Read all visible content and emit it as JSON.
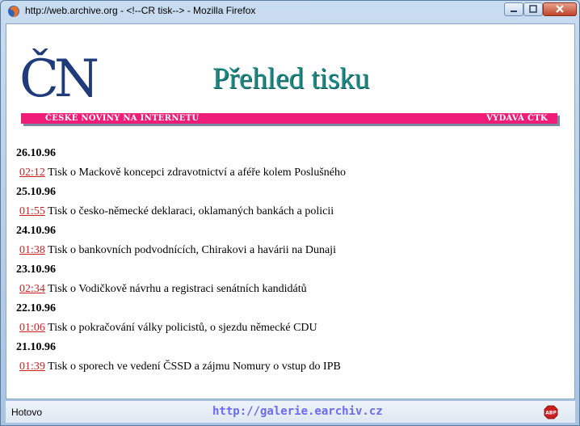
{
  "window": {
    "title": "http://web.archive.org - <!--CR tisk--> - Mozilla Firefox"
  },
  "page": {
    "logo_text": "ČN",
    "title": "Přehled tisku",
    "banner_left": "ČESKÉ NOVINY NA INTERNETU",
    "banner_right": "VYDÁVÁ ČTK",
    "banner_color": "#ef1c78",
    "title_color": "#1a8a84",
    "logo_color": "#1f3b7a",
    "link_color": "#cc2222",
    "entries": [
      {
        "date": "26.10.96",
        "time": "02:12",
        "text": " Tisk o Mackově koncepci zdravotnictví a aféře kolem Poslušného"
      },
      {
        "date": "25.10.96",
        "time": "01:55",
        "text": " Tisk o česko-německé deklaraci, oklamaných bankách a policii"
      },
      {
        "date": "24.10.96",
        "time": "01:38",
        "text": " Tisk o bankovních podvodnících, Chirakovi a havárii na Dunaji"
      },
      {
        "date": "23.10.96",
        "time": "02:34",
        "text": " Tisk o Vodičkově návrhu a registraci senátních kandidátů"
      },
      {
        "date": "22.10.96",
        "time": "01:06",
        "text": " Tisk o pokračování války policistů, o sjezdu německé CDU"
      },
      {
        "date": "21.10.96",
        "time": "01:39",
        "text": " Tisk o sporech ve vedení ČSSD a zájmu Nomury o vstup do IPB"
      }
    ]
  },
  "statusbar": {
    "status": "Hotovo",
    "watermark": "http://galerie.earchiv.cz",
    "addon_icon": "adblock-plus-icon"
  }
}
